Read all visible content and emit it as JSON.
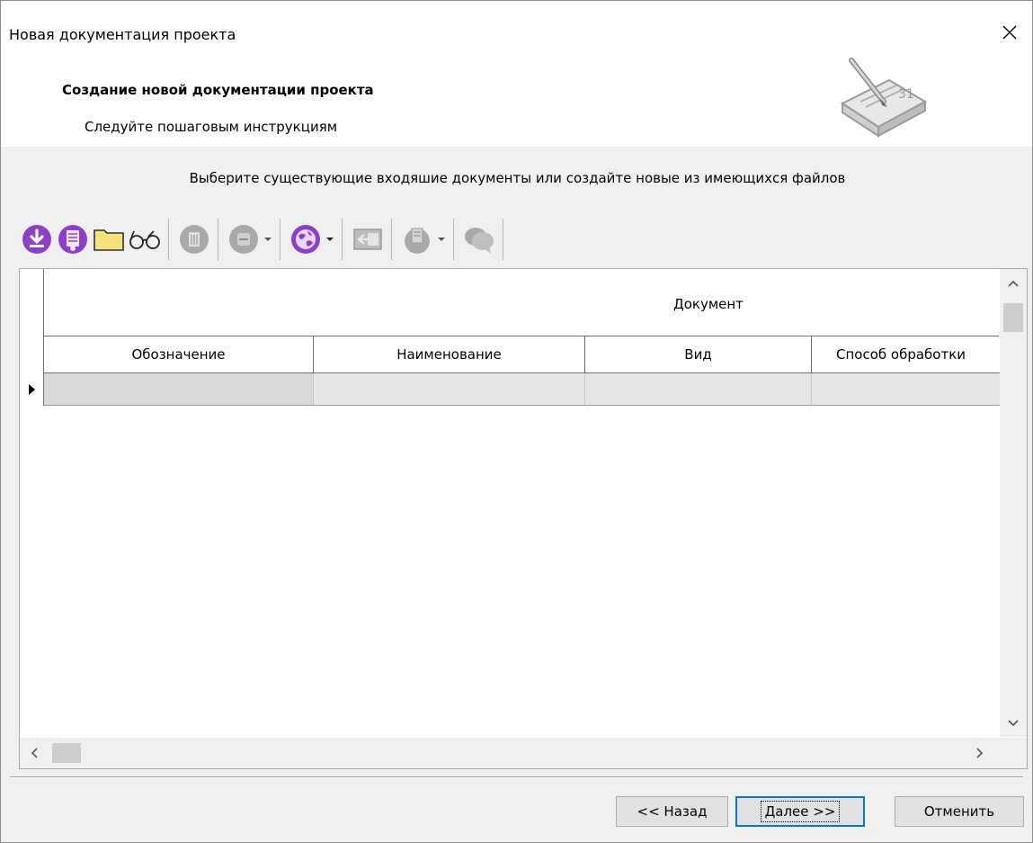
{
  "window": {
    "title": "Новая документация проекта"
  },
  "header": {
    "title": "Создание новой документации проекта",
    "subtitle": "Следуйте пошаговым инструкциям"
  },
  "instruction": "Выберите существующие входяшие документы или создайте новые из имеющихся файлов",
  "toolbar": {
    "items": [
      {
        "icon": "download-circle-icon",
        "enabled": true
      },
      {
        "icon": "document-purple-icon",
        "enabled": true
      },
      {
        "icon": "folder-icon",
        "enabled": true
      },
      {
        "icon": "glasses-icon",
        "enabled": true
      },
      {
        "icon": "delete-icon",
        "enabled": false
      },
      {
        "icon": "minus-circle-icon",
        "enabled": false,
        "dropdown": true
      },
      {
        "icon": "globe-icon",
        "enabled": true,
        "dropdown": true
      },
      {
        "icon": "import-icon",
        "enabled": false
      },
      {
        "icon": "export-icon",
        "enabled": false,
        "dropdown": true
      },
      {
        "icon": "chat-icon",
        "enabled": false
      }
    ]
  },
  "grid": {
    "group_header": "Документ",
    "columns": [
      "Обозначение",
      "Наименование",
      "Вид",
      "Способ обработки"
    ],
    "rows": [
      [
        "",
        "",
        "",
        ""
      ]
    ]
  },
  "buttons": {
    "back": "<< Назад",
    "next": "Далее >>",
    "cancel": "Отменить"
  },
  "colors": {
    "accent": "#0078d7",
    "icon_purple": "#8e3fc9",
    "folder_yellow": "#f5e27a"
  }
}
